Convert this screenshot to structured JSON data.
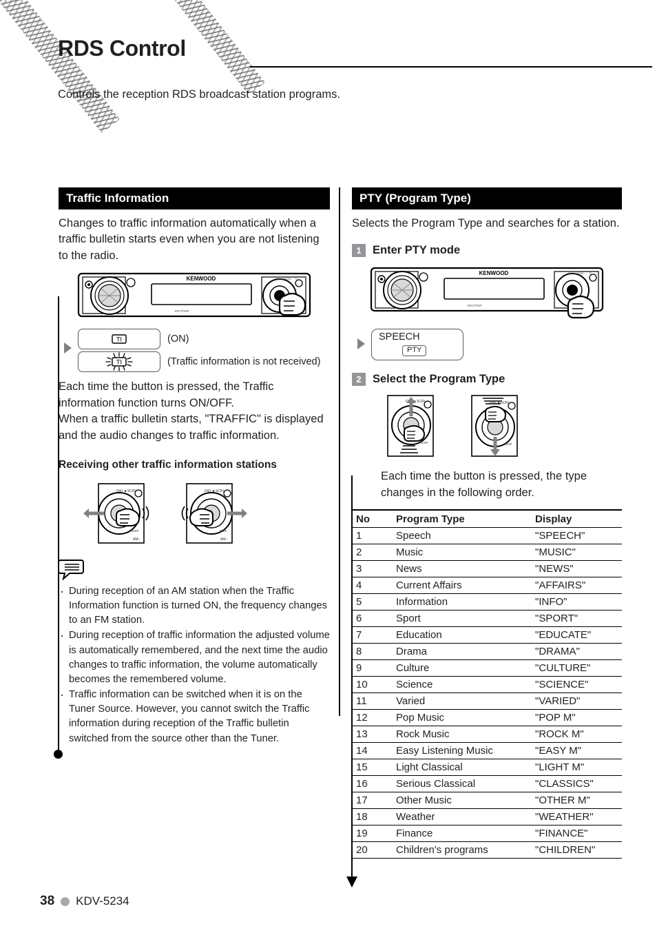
{
  "page": {
    "title": "RDS Control",
    "intro": "Controls the reception RDS broadcast station programs.",
    "number": "38",
    "model": "KDV-5234"
  },
  "colors": {
    "section_header_bg": "#000000",
    "section_header_text": "#ffffff",
    "step_chip_bg": "#939598",
    "body_text": "#231f20",
    "footer_dot": "#a7a9ac",
    "arrow_gray": "#808285"
  },
  "traffic": {
    "heading": "Traffic Information",
    "description": "Changes to traffic information automatically when a traffic bulletin starts even when you are not listening to the radio.",
    "faceplate_brand": "KENWOOD",
    "chips": [
      {
        "display": "TI",
        "blinking": false,
        "note": "(ON)"
      },
      {
        "display": "TI",
        "blinking": true,
        "note": "(Traffic information is not received)"
      }
    ],
    "explanation": "Each time the button is pressed, the Traffic information function turns ON/OFF.\nWhen a traffic bulletin starts, \"TRAFFIC\" is displayed and the audio changes to traffic information.",
    "subheading": "Receiving other traffic information stations",
    "notes": [
      "During reception of an AM station when the Traffic Information function is turned ON, the frequency changes to an FM station.",
      "During reception of traffic information the adjusted volume is automatically remembered, and the next time the audio changes to traffic information, the volume automatically becomes the remembered volume.",
      "Traffic information can be switched when it is on the Tuner Source. However, you cannot switch the Traffic information during reception of the Traffic bulletin switched from the source other than the Tuner."
    ]
  },
  "pty": {
    "heading": "PTY (Program Type)",
    "description": "Selects the Program Type and searches for a station.",
    "faceplate_brand": "KENWOOD",
    "step1": {
      "num": "1",
      "label": "Enter PTY mode"
    },
    "step1_display": {
      "text": "SPEECH",
      "tag": "PTY"
    },
    "step2": {
      "num": "2",
      "label": "Select the Program Type"
    },
    "step2_explanation": "Each time the button is pressed, the type changes in the following order.",
    "table": {
      "headers": [
        "No",
        "Program Type",
        "Display"
      ],
      "rows": [
        [
          "1",
          "Speech",
          "\"SPEECH\""
        ],
        [
          "2",
          "Music",
          "\"MUSIC\""
        ],
        [
          "3",
          "News",
          "\"NEWS\""
        ],
        [
          "4",
          "Current Affairs",
          "\"AFFAIRS\""
        ],
        [
          "5",
          "Information",
          "\"INFO\""
        ],
        [
          "6",
          "Sport",
          "\"SPORT\""
        ],
        [
          "7",
          "Education",
          "\"EDUCATE\""
        ],
        [
          "8",
          "Drama",
          "\"DRAMA\""
        ],
        [
          "9",
          "Culture",
          "\"CULTURE\""
        ],
        [
          "10",
          "Science",
          "\"SCIENCE\""
        ],
        [
          "11",
          "Varied",
          "\"VARIED\""
        ],
        [
          "12",
          "Pop Music",
          "\"POP M\""
        ],
        [
          "13",
          "Rock Music",
          "\"ROCK M\""
        ],
        [
          "14",
          "Easy Listening Music",
          "\"EASY M\""
        ],
        [
          "15",
          "Light Classical",
          "\"LIGHT M\""
        ],
        [
          "16",
          "Serious Classical",
          "\"CLASSICS\""
        ],
        [
          "17",
          "Other Music",
          "\"OTHER M\""
        ],
        [
          "18",
          "Weather",
          "\"WEATHER\""
        ],
        [
          "19",
          "Finance",
          "\"FINANCE\""
        ],
        [
          "20",
          "Children's programs",
          "\"CHILDREN\""
        ]
      ]
    }
  }
}
